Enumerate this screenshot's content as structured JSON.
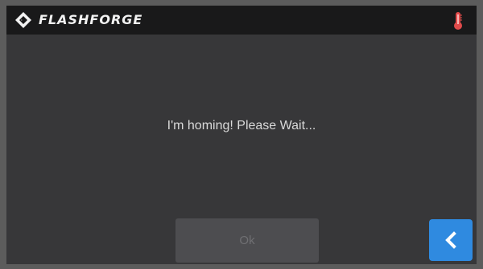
{
  "header": {
    "brand": "FLASHFORGE",
    "logo_icon": "flashforge-logo-icon",
    "status_icon": "thermometer-icon",
    "status_icon_color": "#e14b4b"
  },
  "dialog": {
    "message": "I'm homing! Please Wait...",
    "ok_label": "Ok",
    "ok_enabled": false
  },
  "footer": {
    "back_icon": "chevron-left-icon",
    "back_color": "#2f8ae0"
  }
}
